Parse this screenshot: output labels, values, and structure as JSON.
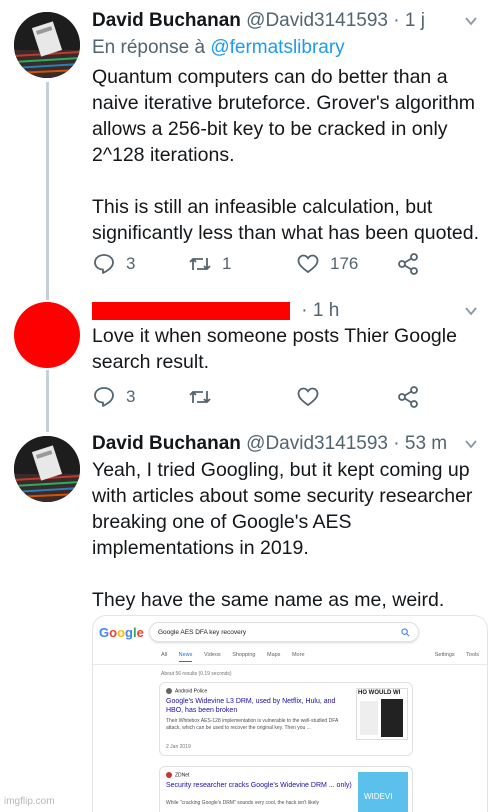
{
  "tweets": [
    {
      "name": "David Buchanan",
      "handle": "@David3141593",
      "time": "· 1 j",
      "reply_prefix": "En réponse à",
      "reply_mention": "@fermatslibrary",
      "lines": [
        "Quantum computers can do better than a",
        "naive iterative bruteforce. Grover's algorithm",
        "allows a 256-bit key to be cracked in only",
        "2^128 iterations.",
        "",
        "This is still an infeasible calculation, but",
        "significantly less than what has been quoted."
      ],
      "reply_count": "3",
      "retweet_count": "1",
      "like_count": "176"
    },
    {
      "time": "· 1 h",
      "lines": [
        "Love it when someone posts Thier Google",
        "search result."
      ],
      "reply_count": "3",
      "retweet_count": "",
      "like_count": ""
    },
    {
      "name": "David Buchanan",
      "handle": "@David3141593",
      "time": "· 53 m",
      "lines": [
        "Yeah, I tried Googling, but it kept coming up",
        "with articles about some security researcher",
        "breaking one of Google's AES",
        "implementations in 2019.",
        "",
        "They have the same name as me, weird."
      ]
    }
  ],
  "google": {
    "logo": "Google",
    "logo_colors": [
      "#4285f4",
      "#ea4335",
      "#fbbc05",
      "#4285f4",
      "#34a853",
      "#ea4335"
    ],
    "query": "Google AES DFA key recovery",
    "tabs": [
      "All",
      "News",
      "Videos",
      "Shopping",
      "Maps",
      "More"
    ],
    "active_tab": "News",
    "settings": "Settings",
    "tools": "Tools",
    "stats": "About 56 results (0.19 seconds)",
    "results": [
      {
        "source": "Android Police",
        "title": "Google's Widevine L3 DRM, used by Netflix, Hulu, and HBO, has been broken",
        "snippet": "Their Whitebox AES-128 implementation is vulnerable to the well-studied DFA attack, which can be used to recover the original key. Then you ...",
        "date": "2 Jan 2019",
        "thumb_text": "HO WOULD WI"
      },
      {
        "source": "ZDNet",
        "title": "Security researcher cracks Google's Widevine DRM ... only)",
        "snippet": "While \"cracking Google's DRM\" sounds very cool, the hack isn't likely",
        "thumb_text": "WIDEVI"
      }
    ]
  },
  "watermark": "imgflip.com",
  "colors": {
    "handle": "#536471",
    "link": "#1d9bf0",
    "redaction": "#ff0000",
    "thread_line": "#c4cfd6"
  }
}
